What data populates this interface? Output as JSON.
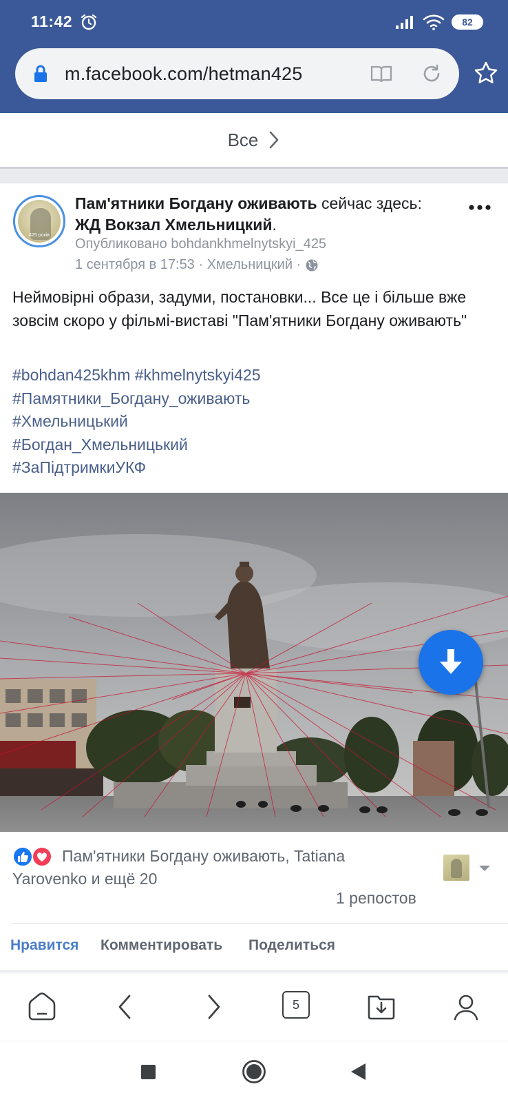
{
  "status_bar": {
    "time": "11:42",
    "battery": "82",
    "icons": [
      "alarm-icon",
      "signal-icon",
      "wifi-icon",
      "battery-icon"
    ]
  },
  "browser": {
    "url": "m.facebook.com/hetman425",
    "icons": [
      "lock-icon",
      "reader-mode-icon",
      "reload-icon",
      "bookmark-star-icon"
    ],
    "tab_count": "5",
    "bottom_icons": [
      "home-icon",
      "back-icon",
      "forward-icon",
      "tabs-icon",
      "downloads-icon",
      "profile-icon"
    ]
  },
  "see_all": {
    "label": "Все"
  },
  "post": {
    "page_name": "Пам'ятники Богдану оживають",
    "checkin_prefix": "сейчас здесь:",
    "place": "ЖД Вокзал Хмельницкий",
    "place_suffix": ".",
    "published_by": "Опубликовано bohdankhmelnytskyi_425",
    "date_line": "1 сентября в 17:53 · Хмельницкий ·",
    "avatar_text": "425 років",
    "text": "Неймовірні образи, задуми, постановки... Все це і більше вже зовсім скоро у фільмі-виставі \"Пам'ятники Богдану оживають\"",
    "hashtags": {
      "h1": "#bohdan425khm",
      "h2": "#khmelnytskyi425",
      "h3": "#Памятники_Богдану_оживають",
      "h4": "#Хмельницький",
      "h5": "#Богдан_Хмельницький",
      "h6": "#ЗаПідтримкиУКФ"
    },
    "reactions_text": "Пам'ятники Богдану оживають, Tatiana Yarovenko и ещё 20",
    "shares": "1 репостов",
    "actions": {
      "like": "Нравится",
      "comment": "Комментировать",
      "share": "Поделиться"
    }
  },
  "colors": {
    "browser_bar": "#3b5998",
    "link_blue": "#4a7dc9",
    "hashtag": "#4a5f8a",
    "fab": "#1a73e8",
    "like": "#1877f2",
    "love": "#f33e58"
  }
}
